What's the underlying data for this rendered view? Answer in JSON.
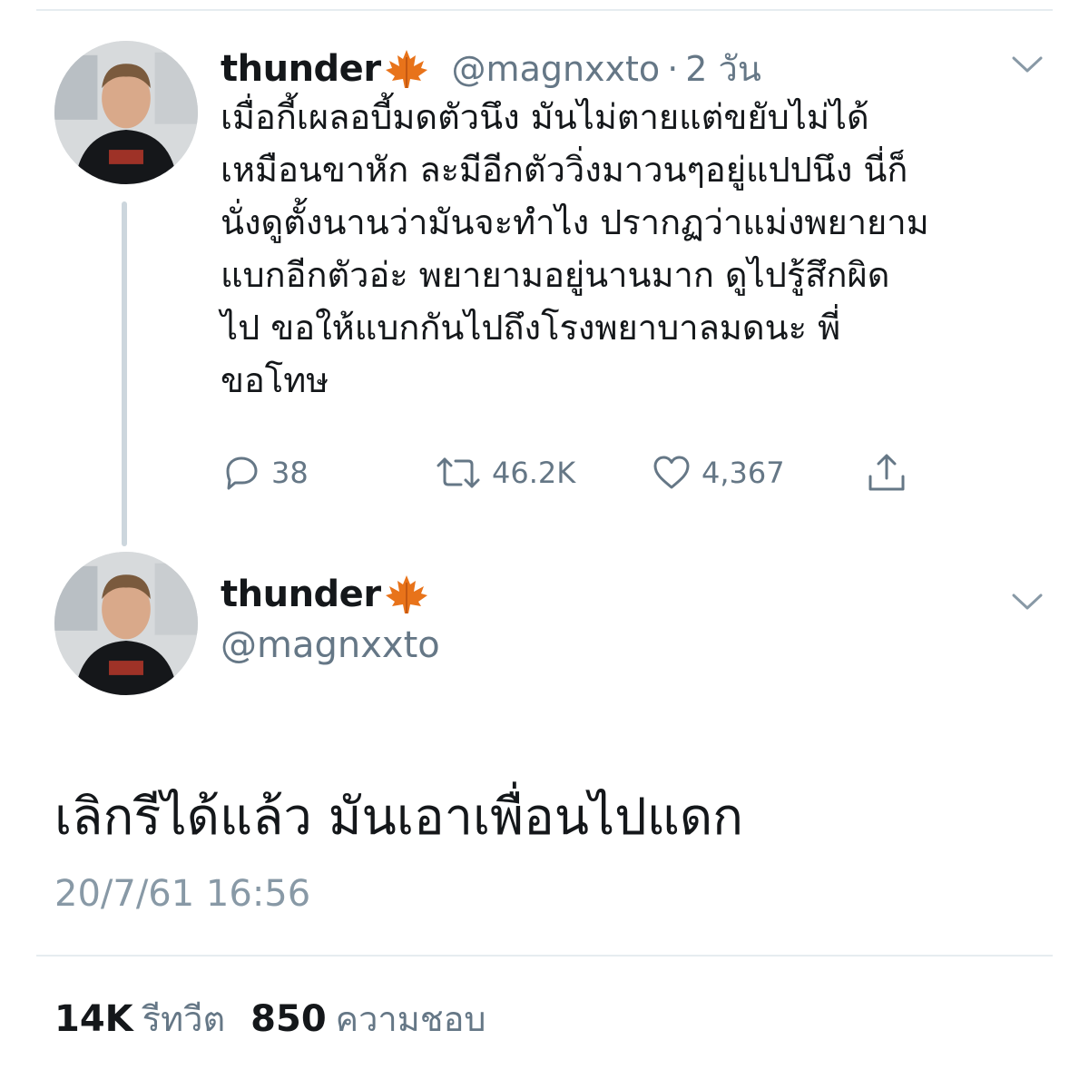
{
  "tweet": {
    "display_name": "thunder",
    "badge": "maple-leaf-icon",
    "handle": "@magnxxto",
    "separator": "·",
    "relative_time": "2 วัน",
    "text_lines": [
      "เมื่อกี้เผลอบี้มดตัวนึง มันไม่ตายแต่ขยับไม่ได้",
      "เหมือนขาหัก ละมีอีกตัววิ่งมาวนๆอยู่แปปนึง นี่ก็",
      "นั่งดูตั้งนานว่ามันจะทำไง ปรากฏว่าแม่งพยายาม",
      "แบกอีกตัวอ่ะ พยายามอยู่นานมาก ดูไปรู้สึกผิด",
      "ไป ขอให้แบกกันไปถึงโรงพยาบาลมดนะ พี่",
      "ขอโทษ"
    ],
    "replies": "38",
    "retweets": "46.2K",
    "likes": "4,367"
  },
  "reply": {
    "display_name": "thunder",
    "badge": "maple-leaf-icon",
    "handle": "@magnxxto",
    "text": "เลิกรีได้แล้ว มันเอาเพื่อนไปแดก",
    "timestamp": "20/7/61 16:56",
    "retweet_count": "14K",
    "retweet_label": "รีทวีต",
    "like_count": "850",
    "like_label": "ความชอบ"
  },
  "colors": {
    "text": "#14171a",
    "secondary": "#657786",
    "timestamp": "#8899a6",
    "divider": "#e6ecf0",
    "thread_line": "#ccd6dd",
    "leaf": "#e8731a"
  }
}
